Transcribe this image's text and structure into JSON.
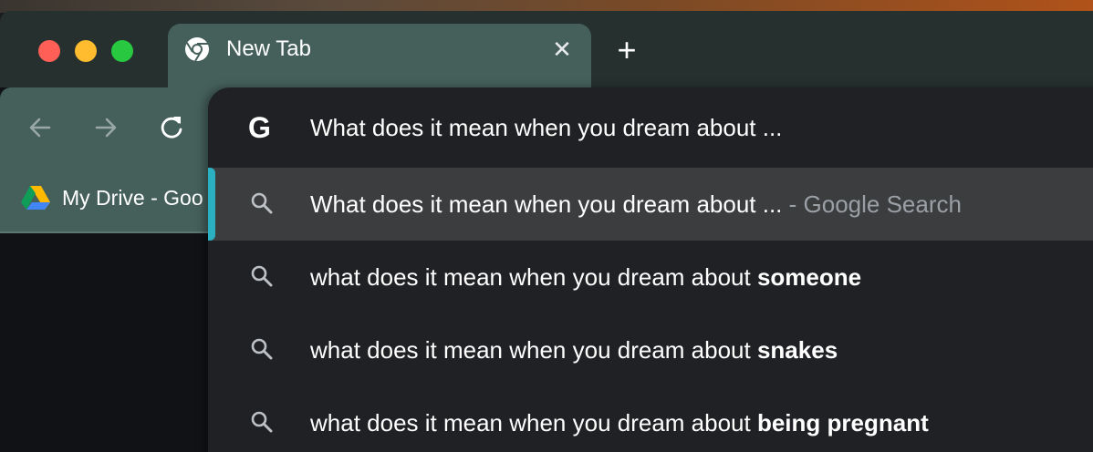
{
  "tab": {
    "title": "New Tab",
    "close_icon": "close-icon",
    "new_tab_icon": "plus-icon"
  },
  "toolbar": {
    "back_icon": "arrow-left-icon",
    "forward_icon": "arrow-right-icon",
    "reload_icon": "reload-icon"
  },
  "bookmarks": [
    {
      "label": "My Drive - Goo",
      "icon": "google-drive-icon"
    }
  ],
  "omnibox": {
    "input_text": "What does it mean when you dream about ...",
    "provider_icon": "google-g-icon",
    "suggestions": [
      {
        "text": "What does it mean when you dream about ...",
        "bold": "",
        "meta": " - Google Search",
        "selected": true
      },
      {
        "text": "what does it mean when you dream about ",
        "bold": "someone",
        "meta": "",
        "selected": false
      },
      {
        "text": "what does it mean when you dream about ",
        "bold": "snakes",
        "meta": "",
        "selected": false
      },
      {
        "text": "what does it mean when you dream about ",
        "bold": "being pregnant",
        "meta": "",
        "selected": false
      }
    ]
  },
  "colors": {
    "tab_active": "#45605b",
    "tabstrip": "#26312f",
    "dropdown_bg": "#202124",
    "selected_row": "#3c3d3f",
    "selected_indicator": "#2bb0c2"
  }
}
